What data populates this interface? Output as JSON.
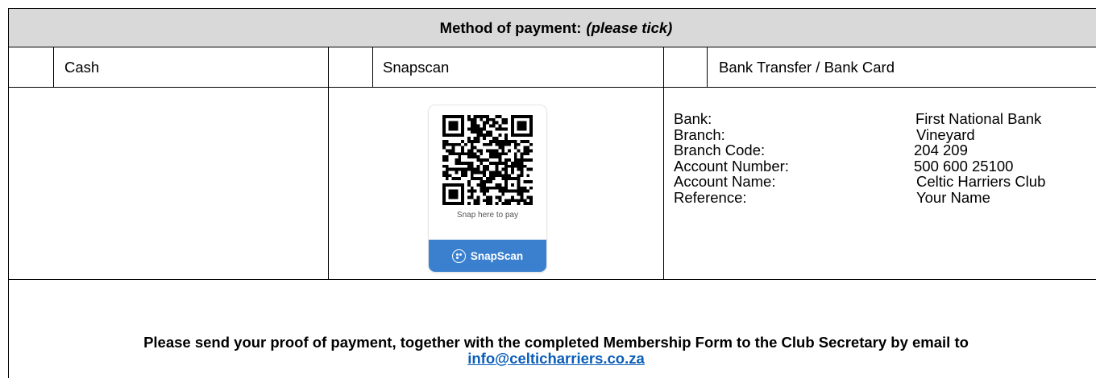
{
  "header": {
    "title": "Method of payment:",
    "note": "(please tick)"
  },
  "options": {
    "cash": "Cash",
    "snapscan": "Snapscan",
    "bank": "Bank Transfer / Bank Card"
  },
  "snapscan_card": {
    "caption": "Snap here to pay",
    "brand": "SnapScan",
    "brand_color": "#3a80cf"
  },
  "bank_details": [
    {
      "label": "Bank:",
      "value": "First National Bank"
    },
    {
      "label": "Branch:",
      "value": "Vineyard"
    },
    {
      "label": "Branch Code:",
      "value": "204 209"
    },
    {
      "label": "Account Number:",
      "value": "500 600 25100"
    },
    {
      "label": "Account Name:",
      "value": "Celtic Harriers Club"
    },
    {
      "label": "Reference:",
      "value": "Your Name"
    }
  ],
  "footer": {
    "message": "Please send your proof of payment, together with the completed Membership Form to the Club Secretary by email to",
    "email": "info@celticharriers.co.za",
    "link_color": "#0a5db8"
  }
}
